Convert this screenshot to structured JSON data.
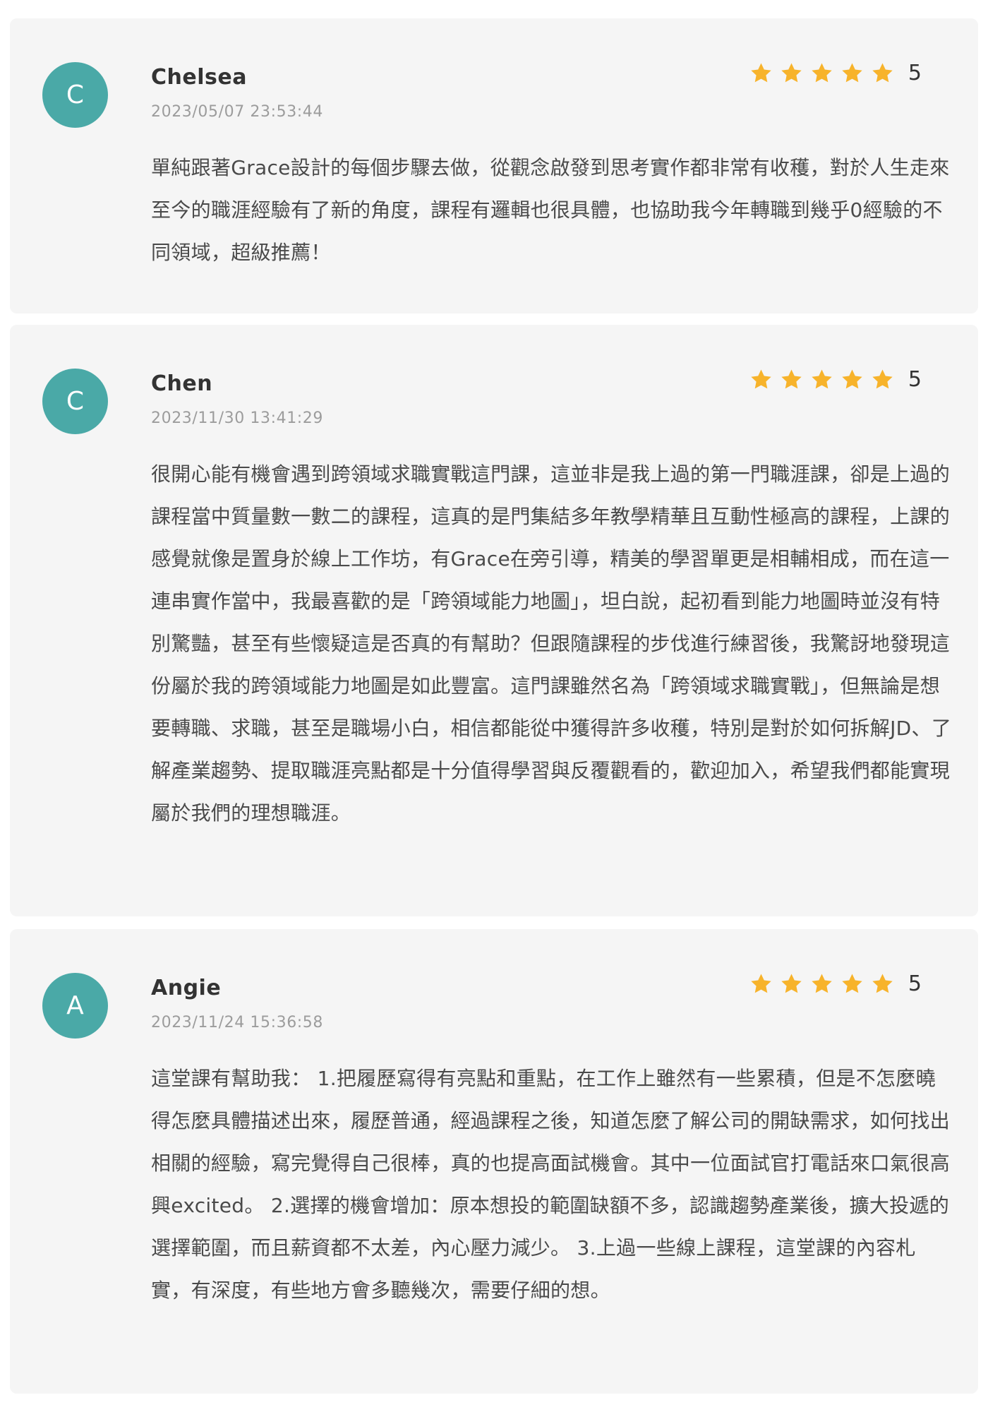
{
  "colors": {
    "card_background": "#f5f5f5",
    "avatar_background": "#4aa9a7",
    "star_color": "#f7b32b",
    "name_color": "#333333",
    "date_color": "#9c9c9c",
    "text_color": "#4a4a4a"
  },
  "icons": {
    "star": "star-icon"
  },
  "reviews": [
    {
      "avatar_letter": "C",
      "name": "Chelsea",
      "date": "2023/05/07 23:53:44",
      "stars": 5,
      "rating": "5",
      "text": "單純跟著Grace設計的每個步驟去做，從觀念啟發到思考實作都非常有收穫，對於人生走來至今的職涯經驗有了新的角度，課程有邏輯也很具體，也協助我今年轉職到幾乎0經驗的不同領域，超級推薦！"
    },
    {
      "avatar_letter": "C",
      "name": "Chen",
      "date": "2023/11/30 13:41:29",
      "stars": 5,
      "rating": "5",
      "text": "很開心能有機會遇到跨領域求職實戰這門課，這並非是我上過的第一門職涯課，卻是上過的課程當中質量數一數二的課程，這真的是門集結多年教學精華且互動性極高的課程，上課的感覺就像是置身於線上工作坊，有Grace在旁引導，精美的學習單更是相輔相成，而在這一連串實作當中，我最喜歡的是「跨領域能力地圖」，坦白說，起初看到能力地圖時並沒有特別驚豔，甚至有些懷疑這是否真的有幫助？但跟隨課程的步伐進行練習後，我驚訝地發現這份屬於我的跨領域能力地圖是如此豐富。這門課雖然名為「跨領域求職實戰」，但無論是想要轉職、求職，甚至是職場小白，相信都能從中獲得許多收穫，特別是對於如何拆解JD、了解產業趨勢、提取職涯亮點都是十分值得學習與反覆觀看的，歡迎加入，希望我們都能實現屬於我們的理想職涯。"
    },
    {
      "avatar_letter": "A",
      "name": "Angie",
      "date": "2023/11/24 15:36:58",
      "stars": 5,
      "rating": "5",
      "text": "這堂課有幫助我： 1.把履歷寫得有亮點和重點，在工作上雖然有一些累積，但是不怎麼曉得怎麼具體描述出來，履歷普通，經過課程之後，知道怎麼了解公司的開缺需求，如何找出相關的經驗，寫完覺得自己很棒，真的也提高面試機會。其中一位面試官打電話來口氣很高興excited。 2.選擇的機會增加：原本想投的範圍缺額不多，認識趨勢產業後，擴大投遞的選擇範圍，而且薪資都不太差，內心壓力減少。 3.上過一些線上課程，這堂課的內容札實，有深度，有些地方會多聽幾次，需要仔細的想。"
    }
  ]
}
